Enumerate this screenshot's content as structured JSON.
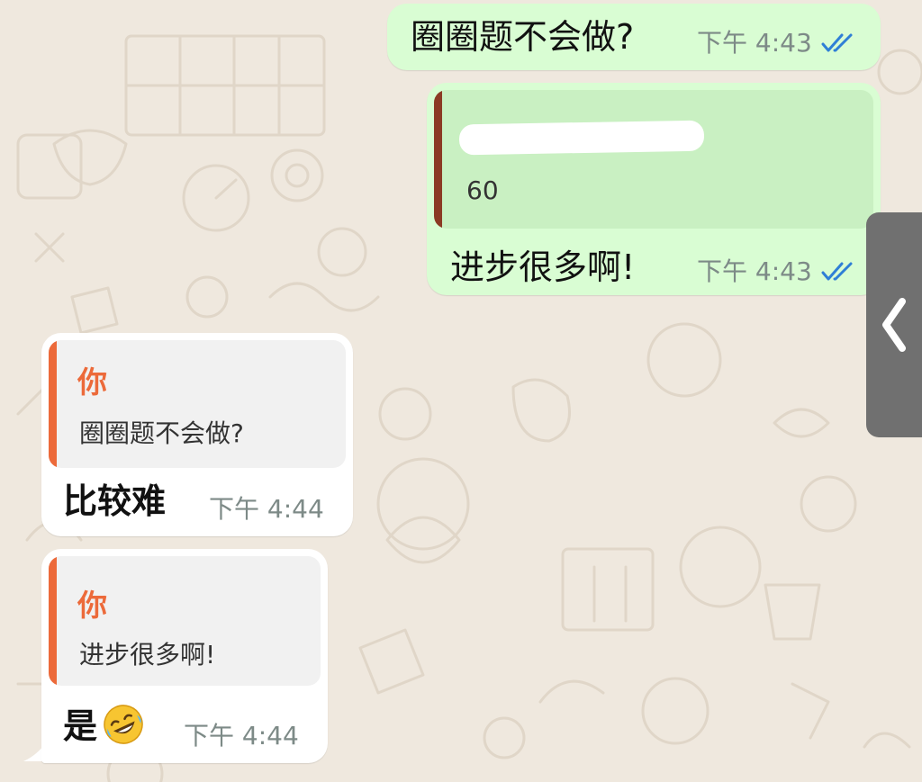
{
  "messages": {
    "m1": {
      "text": "圈圈题不会做?",
      "time": "下午 4:43"
    },
    "m2": {
      "quote_text": "60",
      "text": "进步很多啊!",
      "time": "下午 4:43"
    },
    "m3": {
      "quote_author": "你",
      "quote_text": "圈圈题不会做?",
      "text": "比较难",
      "time": "下午 4:44"
    },
    "m4": {
      "quote_author": "你",
      "quote_text": "进步很多啊!",
      "text": "是",
      "emoji": "rofl-emoji",
      "time": "下午 4:44"
    }
  },
  "colors": {
    "outgoing_bubble": "#d9fdd3",
    "incoming_bubble": "#ffffff",
    "quote_bar_outgoing": "#8b3a24",
    "quote_bar_incoming": "#ec6a3a",
    "quote_author": "#ec6a3a",
    "read_ticks": "#2f7fd6",
    "timestamp": "#7d8a87"
  },
  "icons": {
    "read_status": "double-check-icon",
    "side_panel": "chevron-left-icon"
  }
}
